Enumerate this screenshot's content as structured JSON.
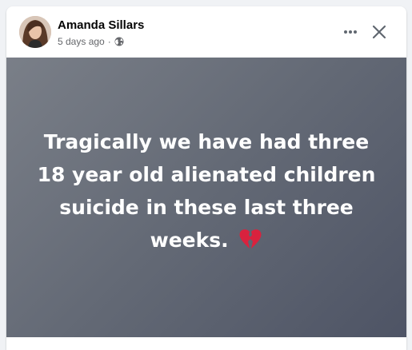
{
  "post": {
    "author": "Amanda Sillars",
    "time": "5 days ago",
    "separator": "·",
    "privacy_icon": "globe-icon",
    "text": "Tragically we have had three 18 year old alienated children suicide in these last three weeks.",
    "emoji_icon": "broken-heart-icon",
    "background_colors": [
      "#7a7f88",
      "#4e5465"
    ],
    "text_color": "#ffffff"
  },
  "icons": {
    "more": "more-horizontal-icon",
    "close": "close-icon"
  }
}
